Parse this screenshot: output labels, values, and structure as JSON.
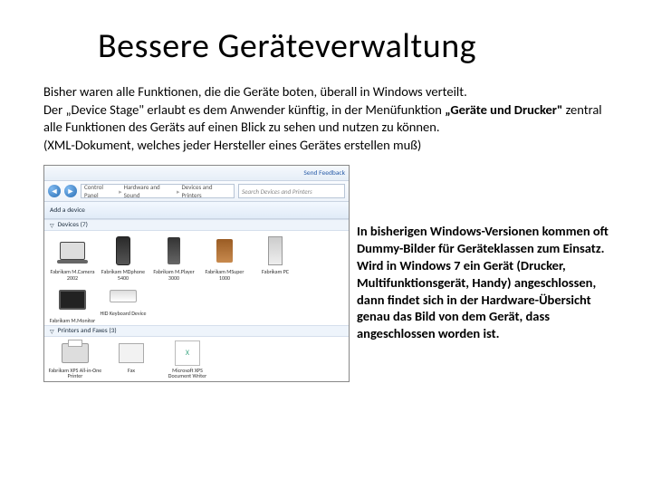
{
  "title": "Bessere Geräteverwaltung",
  "intro": {
    "line1": "Bisher waren alle Funktionen, die die Geräte boten, überall in Windows verteilt.",
    "line2a": "Der „Device Stage\" erlaubt es dem Anwender künftig,  in der Menüfunktion ",
    "line2b": "„Geräte und Drucker\"",
    "line2c": " zentral alle Funktionen des Geräts auf einen Blick zu sehen und nutzen zu können.",
    "line3": "(XML-Dokument, welches jeder Hersteller eines Gerätes erstellen muß)"
  },
  "screenshot": {
    "send_feedback": "Send Feedback",
    "breadcrumb": [
      "Control Panel",
      "Hardware and Sound",
      "Devices and Printers"
    ],
    "search_placeholder": "Search Devices and Printers",
    "toolbar_add": "Add a device",
    "section_devices": "Devices (7)",
    "section_printers": "Printers and Faxes (3)",
    "devices": [
      {
        "name": "Fabrikam M.Camera 2002"
      },
      {
        "name": "Fabrikam MDphone 5400"
      },
      {
        "name": "Fabrikam M.Player 3000"
      },
      {
        "name": "Fabrikam MSuper 1000"
      },
      {
        "name": "Fabrikam PC"
      },
      {
        "name": "Fabrikam M.Monitor"
      },
      {
        "name": "HID Keyboard Device"
      }
    ],
    "printers": [
      {
        "name": "Fabrikam XPS All-in-One Printer"
      },
      {
        "name": "Fax"
      },
      {
        "name": "Microsoft XPS Document Writer"
      }
    ]
  },
  "caption": "In bisherigen Windows-Versionen kommen oft Dummy-Bilder für Geräteklassen zum Einsatz. Wird in Windows 7 ein Gerät (Drucker, Multifunktionsgerät, Handy) angeschlossen, dann findet sich in der Hardware-Übersicht genau das Bild von dem Gerät, dass angeschlossen worden ist."
}
